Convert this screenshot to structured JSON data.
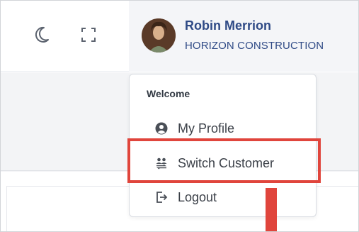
{
  "header": {
    "theme_toggle_icon": "moon-icon",
    "fullscreen_icon": "fullscreen-icon",
    "user": {
      "name": "Robin Merrion",
      "company": "HORIZON CONSTRUCTION",
      "avatar_icon": "avatar"
    }
  },
  "dropdown": {
    "header": "Welcome",
    "items": [
      {
        "label": "My Profile",
        "icon": "user-circle-icon"
      },
      {
        "label": "Switch Customer",
        "icon": "users-switch-icon"
      },
      {
        "label": "Logout",
        "icon": "logout-icon"
      }
    ]
  },
  "colors": {
    "name_text": "#2f4a86",
    "highlight": "#e0453c",
    "menu_text": "#3a3f47"
  }
}
